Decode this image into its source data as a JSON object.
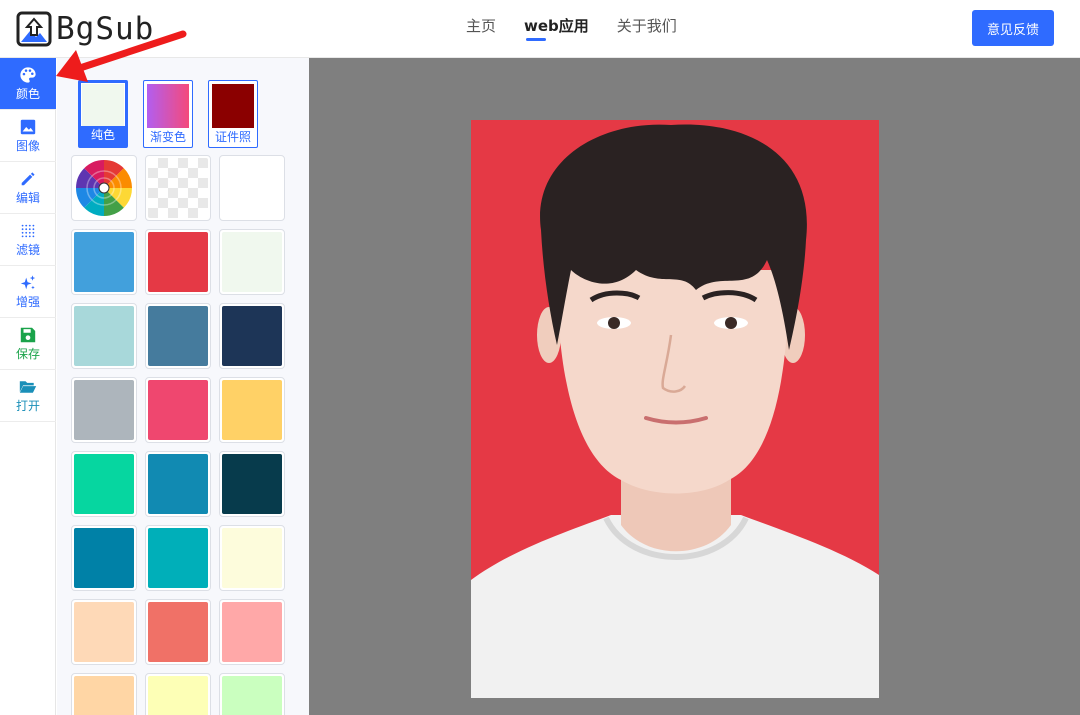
{
  "header": {
    "brand": "BgSub",
    "nav": [
      {
        "label": "主页",
        "active": false
      },
      {
        "label": "web应用",
        "active": true
      },
      {
        "label": "关于我们",
        "active": false
      }
    ],
    "feedback_label": "意见反馈",
    "accent_color": "#2f6bff"
  },
  "sidebar": {
    "items": [
      {
        "label": "颜色",
        "icon": "palette-icon",
        "active": true
      },
      {
        "label": "图像",
        "icon": "image-icon",
        "active": false
      },
      {
        "label": "编辑",
        "icon": "pencil-icon",
        "active": false
      },
      {
        "label": "滤镜",
        "icon": "filter-dots-icon",
        "active": false
      },
      {
        "label": "增强",
        "icon": "sparkle-icon",
        "active": false
      },
      {
        "label": "保存",
        "icon": "floppy-disk-icon",
        "active": false
      },
      {
        "label": "打开",
        "icon": "folder-open-icon",
        "active": false
      }
    ]
  },
  "color_panel": {
    "tabs": [
      {
        "label": "纯色",
        "active": true,
        "preview": "#f0f8ee"
      },
      {
        "label": "渐变色",
        "active": false,
        "preview": "gradient"
      },
      {
        "label": "证件照",
        "active": false,
        "preview": "#8b0000"
      }
    ],
    "special_swatches": [
      "color-wheel",
      "transparent",
      "#ffffff"
    ],
    "swatches": [
      "#42a0dc",
      "#e53945",
      "#f0f8ee",
      "#a8d8da",
      "#457b9d",
      "#1d3557",
      "#adb5bc",
      "#ef476f",
      "#ffd166",
      "#06d6a0",
      "#118ab2",
      "#073b4c",
      "#0081a7",
      "#00afb9",
      "#fdfcdc",
      "#fed9b7",
      "#f07167",
      "#ffa8a8",
      "#ffd6a5",
      "#fdffb6",
      "#caffbf"
    ]
  },
  "canvas": {
    "background_color": "#e53945"
  }
}
